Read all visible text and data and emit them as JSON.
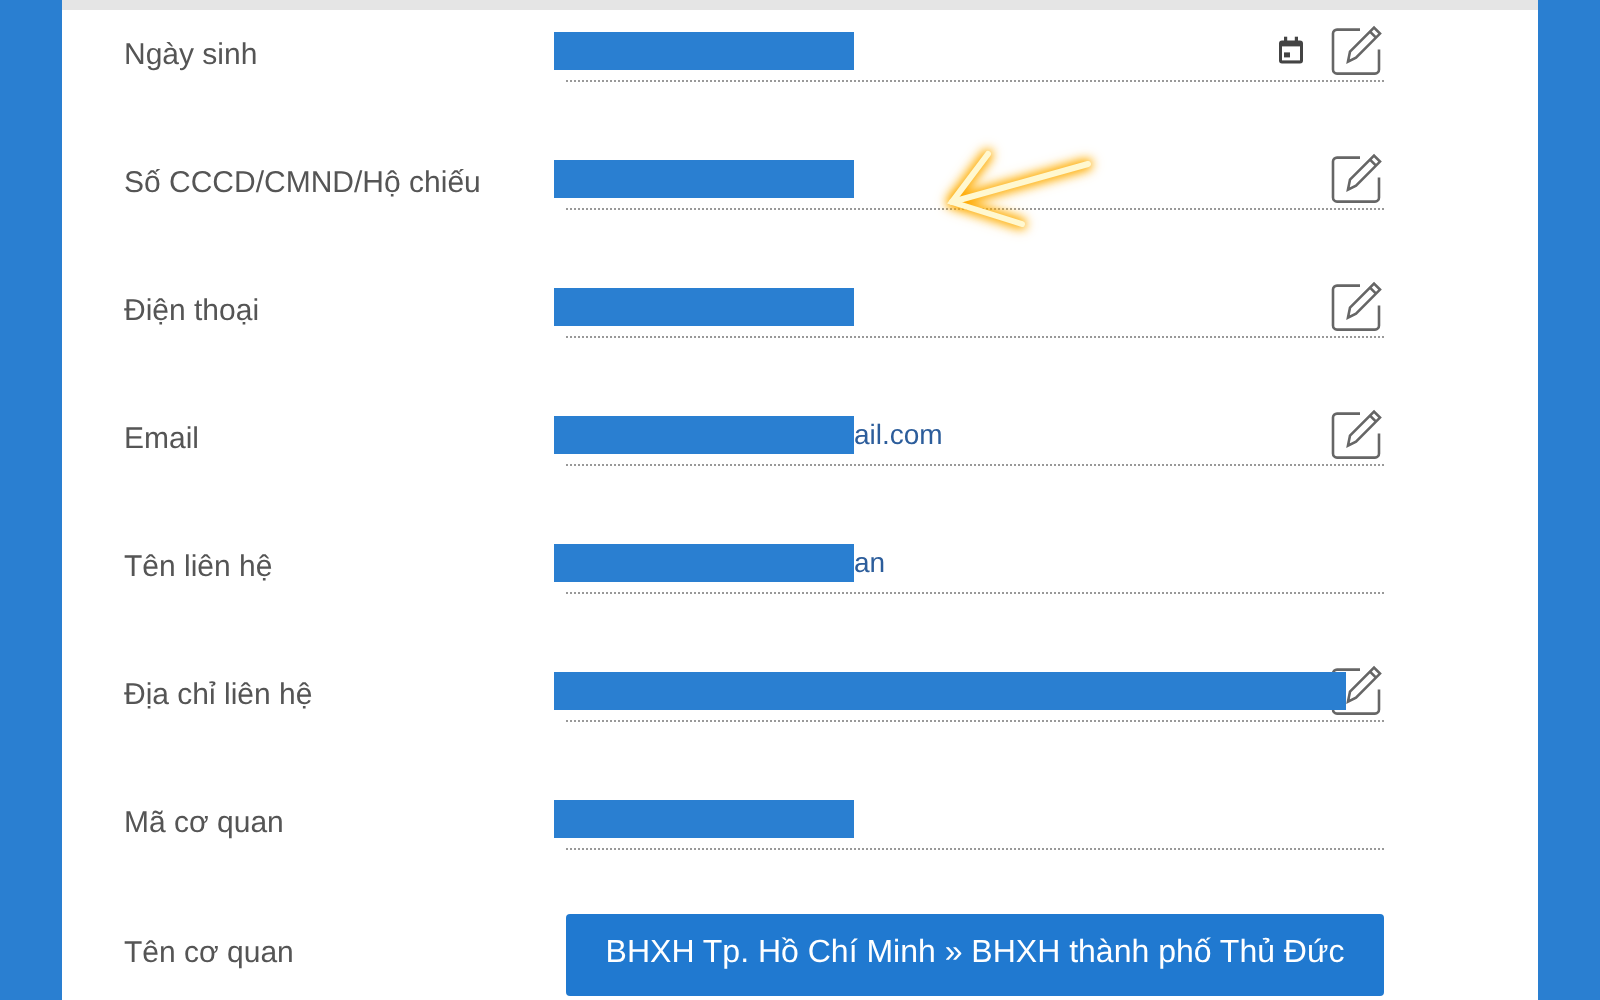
{
  "form": {
    "rows": [
      {
        "kind": "field",
        "label": "Ngày sinh",
        "redaction_wide": false,
        "calendar": true,
        "editable": true,
        "pointer": false
      },
      {
        "kind": "field",
        "label": "Số CCCD/CMND/Hộ chiếu",
        "redaction_wide": false,
        "calendar": false,
        "editable": true,
        "pointer": true
      },
      {
        "kind": "field",
        "label": "Điện thoại",
        "redaction_wide": false,
        "calendar": false,
        "editable": true,
        "pointer": false
      },
      {
        "kind": "field",
        "label": "Email",
        "redaction_wide": false,
        "value_fragment": "ail.com",
        "calendar": false,
        "editable": true,
        "pointer": false
      },
      {
        "kind": "field",
        "label": "Tên liên hệ",
        "redaction_wide": false,
        "value_fragment": "an",
        "calendar": false,
        "editable": false,
        "pointer": false
      },
      {
        "kind": "field",
        "label": "Địa chỉ liên hệ",
        "redaction_wide": true,
        "calendar": false,
        "editable": true,
        "pointer": false
      },
      {
        "kind": "field",
        "label": "Mã cơ quan",
        "redaction_wide": false,
        "calendar": false,
        "editable": false,
        "pointer": false
      },
      {
        "kind": "button",
        "label": "Tên cơ quan",
        "value": "BHXH Tp. Hồ Chí Minh » BHXH thành phố Thủ Đức"
      }
    ]
  }
}
